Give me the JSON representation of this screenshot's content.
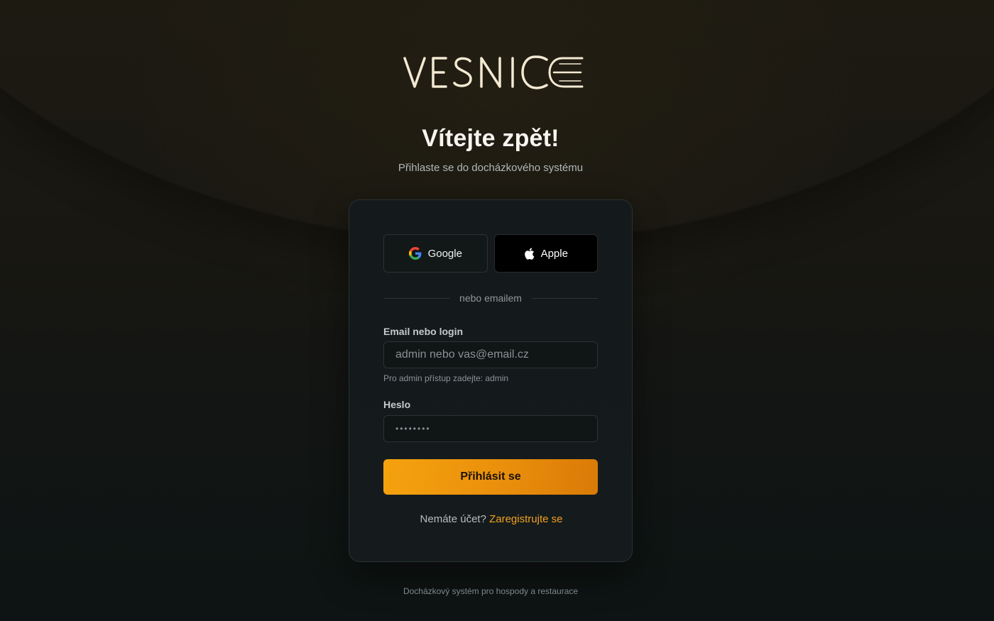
{
  "brand": {
    "logo_text": "VESNICE"
  },
  "header": {
    "title": "Vítejte zpět!",
    "subtitle": "Přihlaste se do docházkového systému"
  },
  "social": {
    "google_label": "Google",
    "apple_label": "Apple"
  },
  "divider_label": "nebo emailem",
  "form": {
    "email": {
      "label": "Email nebo login",
      "placeholder": "admin nebo vas@email.cz",
      "value": "",
      "hint": "Pro admin přístup zadejte: admin"
    },
    "password": {
      "label": "Heslo",
      "placeholder": "••••••••",
      "value": ""
    },
    "submit_label": "Přihlásit se"
  },
  "register": {
    "prompt": "Nemáte účet?",
    "link_label": "Zaregistrujte se"
  },
  "footer_text": "Docházkový systém pro hospody a restaurace",
  "colors": {
    "accent": "#f5a20e",
    "link": "#f0a020",
    "card_bg": "#141a1b",
    "logo": "#f3e9d2"
  },
  "icons": {
    "google": "google-icon",
    "apple": "apple-icon"
  }
}
